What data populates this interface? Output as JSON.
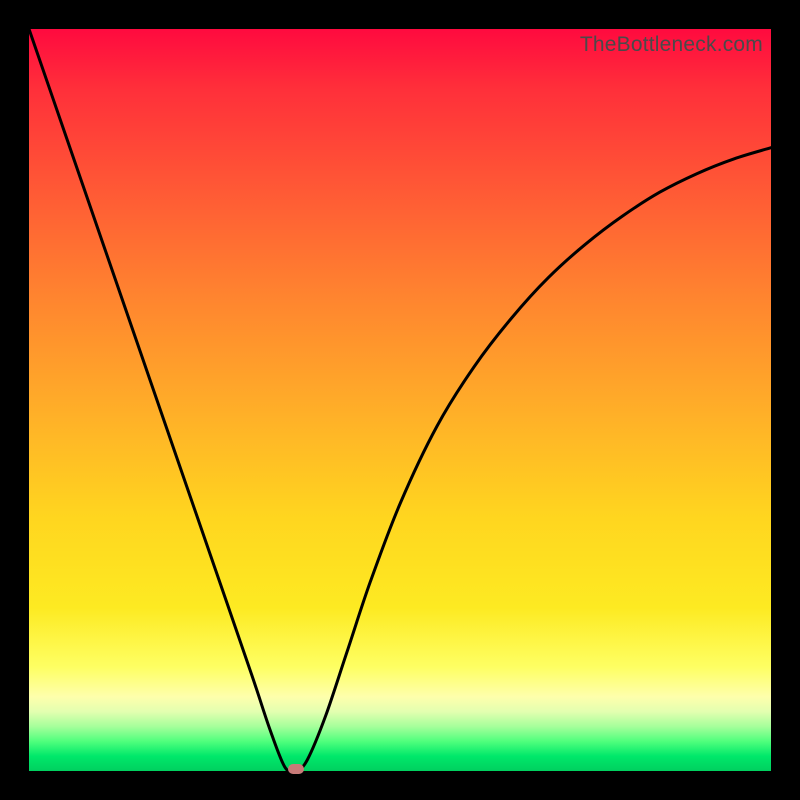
{
  "watermark": "TheBottleneck.com",
  "chart_data": {
    "type": "line",
    "title": "",
    "xlabel": "",
    "ylabel": "",
    "xlim": [
      0,
      1
    ],
    "ylim": [
      0,
      1
    ],
    "series": [
      {
        "name": "bottleneck-curve",
        "x": [
          0.0,
          0.05,
          0.1,
          0.15,
          0.2,
          0.25,
          0.3,
          0.325,
          0.345,
          0.36,
          0.375,
          0.4,
          0.43,
          0.46,
          0.5,
          0.55,
          0.6,
          0.65,
          0.7,
          0.75,
          0.8,
          0.85,
          0.9,
          0.95,
          1.0
        ],
        "y": [
          1.0,
          0.855,
          0.71,
          0.565,
          0.42,
          0.275,
          0.13,
          0.055,
          0.005,
          0.0,
          0.015,
          0.075,
          0.165,
          0.255,
          0.36,
          0.465,
          0.545,
          0.61,
          0.665,
          0.71,
          0.748,
          0.78,
          0.805,
          0.825,
          0.84
        ]
      }
    ],
    "marker": {
      "x": 0.36,
      "y": 0.003
    },
    "gradient_stops": [
      {
        "pos": 0.0,
        "color": "#ff0a3f"
      },
      {
        "pos": 0.5,
        "color": "#ffb028"
      },
      {
        "pos": 0.88,
        "color": "#feff8a"
      },
      {
        "pos": 1.0,
        "color": "#00d05f"
      }
    ]
  }
}
